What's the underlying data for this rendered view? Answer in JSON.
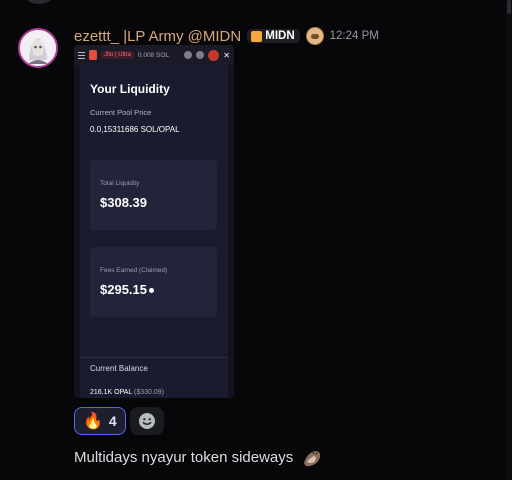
{
  "message": {
    "username": "ezettt_ |LP Army @MIDN",
    "guild_tag": "MIDN",
    "timestamp": "12:24 PM",
    "text": "Multidays nyayur token sideways",
    "icons": {
      "avatar": "avatar-image",
      "guild_tag_icon": "server-tag-icon",
      "role_icon": "role-icon",
      "trailing_emoji": "otter-emoji"
    }
  },
  "attachment": {
    "status_bar": {
      "tag": "Jito | Ultra",
      "sol": "0.008 SOL"
    },
    "title": "Your Liquidity",
    "pool_price_label": "Current Pool Price",
    "pool_price_value": "0.0,15311686 SOL/OPAL",
    "total_liquidity_label": "Total Liquidity",
    "total_liquidity_value": "$308.39",
    "fees_label": "Fees Earned (Claimed)",
    "fees_value": "$295.15",
    "balance_label": "Current Balance",
    "balance_amount": "216.1K OPAL",
    "balance_usd": "($330.09)"
  },
  "reactions": [
    {
      "emoji": "🔥",
      "count": "4",
      "active": true
    }
  ],
  "add_reaction_icon": "smiley-add-reaction-icon"
}
